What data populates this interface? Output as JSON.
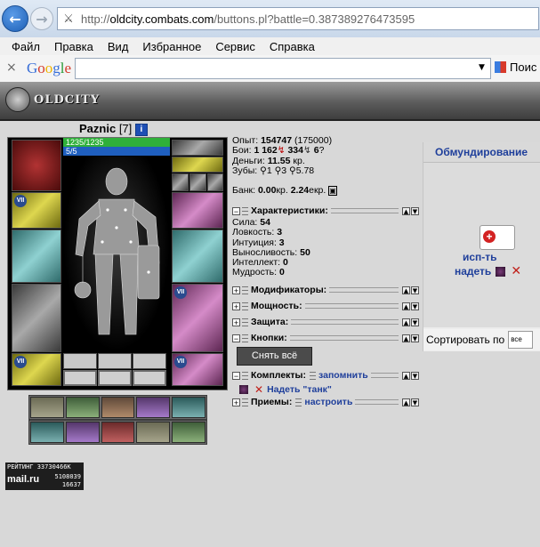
{
  "browser": {
    "url_prefix": "http://",
    "url_domain": "oldcity.combats.com",
    "url_path": "/buttons.pl?battle=0.387389276473595",
    "menu": [
      "Файл",
      "Правка",
      "Вид",
      "Избранное",
      "Сервис",
      "Справка"
    ],
    "google_logo": "Google",
    "search_button": "Поис"
  },
  "game": {
    "logo": "OLDCITY"
  },
  "character": {
    "name": "Paznic",
    "level": "[7]",
    "info_icon": "i",
    "hp": "1235/1235",
    "mp": "5/5",
    "slot_badge": "VII"
  },
  "stats": {
    "exp_label": "Опыт:",
    "exp_value": "154747",
    "exp_next": "(175000)",
    "fights_label": "Бои:",
    "wins": "1 162",
    "losses": "334",
    "draws": "6",
    "money_label": "Деньги:",
    "money": "11.55",
    "money_unit": "кр.",
    "teeth_label": "Зубы:",
    "teeth": "⚲1 ⚲3 ⚲5.78",
    "bank_label": "Банк:",
    "bank_kr": "0.00",
    "bank_kr_unit": "кр.",
    "bank_ekr": "2.24",
    "bank_ekr_unit": "екр."
  },
  "sections": {
    "characteristics": "Характеристики:",
    "modifiers": "Модификаторы:",
    "power": "Мощность:",
    "protection": "Защита:",
    "buttons": "Кнопки:",
    "sets": "Комплекты:",
    "sets_link": "запомнить",
    "techniques": "Приемы:",
    "techniques_link": "настроить"
  },
  "attributes": [
    {
      "label": "Сила:",
      "value": "54"
    },
    {
      "label": "Ловкость:",
      "value": "3"
    },
    {
      "label": "Интуиция:",
      "value": "3"
    },
    {
      "label": "Выносливость:",
      "value": "50"
    },
    {
      "label": "Интеллект:",
      "value": "0"
    },
    {
      "label": "Мудрость:",
      "value": "0"
    }
  ],
  "unequip_button": "Снять всё",
  "set_item": "Надеть \"танк\"",
  "right_panel": {
    "title": "Обмундирование",
    "use_link": "исп-ть",
    "wear_link": "надеть",
    "sort_label": "Сортировать по",
    "sort_value": "все"
  },
  "counter": {
    "rating": "РЕЙТИНГ 33730466К",
    "brand": "mail.ru",
    "n1": "5108039",
    "n2": "16637"
  },
  "colors": {
    "accent": "#1f3f9b",
    "hp": "#2fb03a",
    "mp": "#1f5fbf",
    "red": "#c0201a"
  }
}
